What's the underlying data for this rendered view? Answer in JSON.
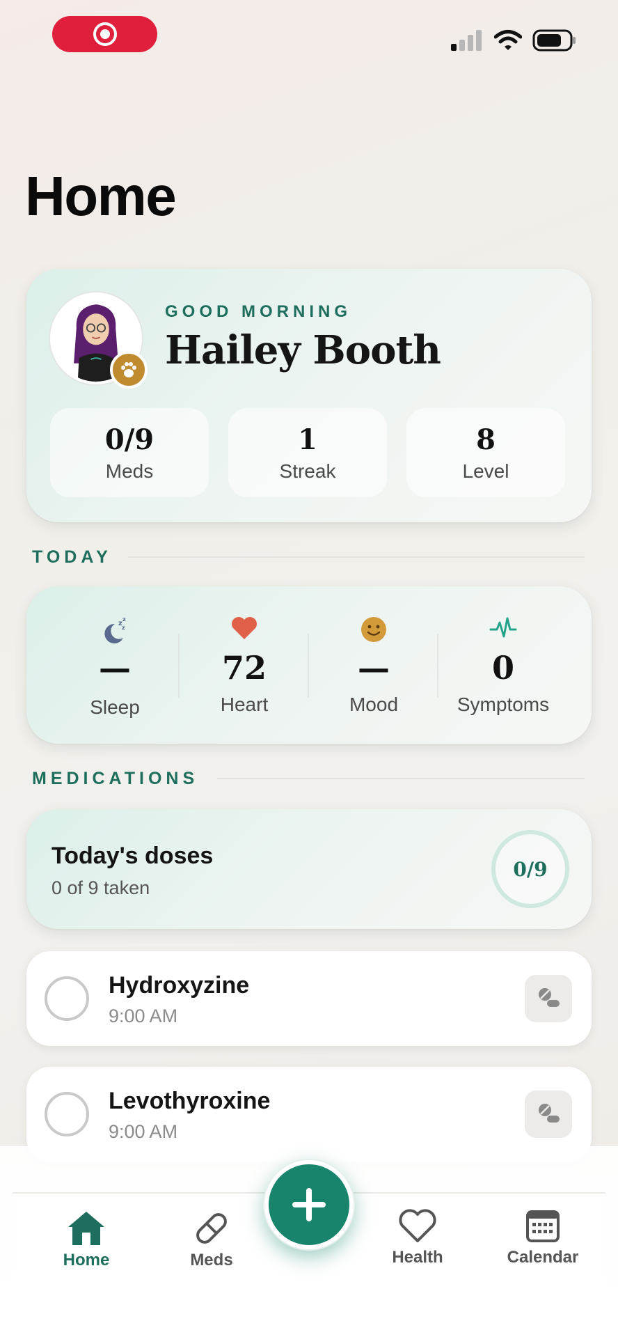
{
  "status_bar": {
    "record_icon": "record-target-icon",
    "signal_icon": "cellular-signal-icon",
    "wifi_icon": "wifi-icon",
    "battery_icon": "battery-icon",
    "record_color": "#e01f3c"
  },
  "page": {
    "title": "Home"
  },
  "profile": {
    "greeting": "GOOD MORNING",
    "name": "Hailey Booth",
    "avatar_icon": "avatar",
    "badge_icon": "paw-icon",
    "stats": [
      {
        "value": "0/9",
        "label": "Meds"
      },
      {
        "value": "1",
        "label": "Streak"
      },
      {
        "value": "8",
        "label": "Level"
      }
    ]
  },
  "today": {
    "header": "TODAY",
    "metrics": [
      {
        "icon": "sleep-moon-icon",
        "value": "—",
        "label": "Sleep"
      },
      {
        "icon": "heart-icon",
        "value": "72",
        "label": "Heart"
      },
      {
        "icon": "smiley-icon",
        "value": "—",
        "label": "Mood"
      },
      {
        "icon": "pulse-icon",
        "value": "0",
        "label": "Symptoms"
      }
    ]
  },
  "medications": {
    "header": "MEDICATIONS",
    "summary": {
      "title": "Today's doses",
      "subtitle": "0 of 9 taken",
      "ring": "0/9"
    },
    "items": [
      {
        "name": "Hydroxyzine",
        "time": "9:00 AM",
        "icon": "pill-icon"
      },
      {
        "name": "Levothyroxine",
        "time": "9:00 AM",
        "icon": "pill-icon"
      }
    ]
  },
  "tabbar": {
    "tabs": [
      {
        "label": "Home",
        "icon": "home-icon",
        "active": true
      },
      {
        "label": "Meds",
        "icon": "pill-capsule-icon",
        "active": false
      },
      {
        "label": "Health",
        "icon": "heart-outline-icon",
        "active": false
      },
      {
        "label": "Calendar",
        "icon": "calendar-icon",
        "active": false
      }
    ],
    "fab_icon": "plus-icon"
  },
  "colors": {
    "accent": "#1e6e5d",
    "fab": "#17846b",
    "heart": "#e0604a",
    "mood": "#d39a3a",
    "sleep": "#5a6a8e"
  }
}
